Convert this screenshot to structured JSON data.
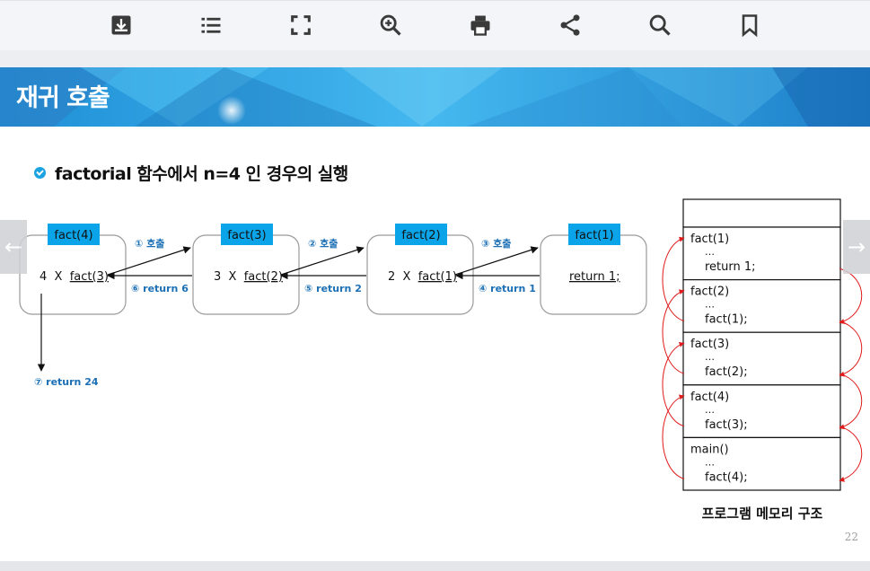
{
  "toolbar": {
    "buttons": [
      "download-icon",
      "list-icon",
      "fullscreen-icon",
      "zoom-in-icon",
      "print-icon",
      "share-icon",
      "search-icon",
      "bookmark-icon"
    ]
  },
  "slide": {
    "title": "재귀 호출",
    "heading": "factorial 함수에서 n=4 인 경우의 실행",
    "page_number": "22"
  },
  "diagram": {
    "boxes": [
      {
        "tag": "fact(4)",
        "prefix": "4  X  ",
        "call": "fact(3)"
      },
      {
        "tag": "fact(3)",
        "prefix": "3  X  ",
        "call": "fact(2)"
      },
      {
        "tag": "fact(2)",
        "prefix": "2  X  ",
        "call": "fact(1)"
      },
      {
        "tag": "fact(1)",
        "prefix": "",
        "call": "return 1;"
      }
    ],
    "calls": [
      "① 호출",
      "② 호출",
      "③ 호출"
    ],
    "returns": [
      "⑥ return 6",
      "⑤ return 2",
      "④ return 1"
    ],
    "final_return": "⑦ return 24",
    "memory": {
      "frames": [
        {
          "name": "fact(1)",
          "dots": "…",
          "stmt": "return 1;"
        },
        {
          "name": "fact(2)",
          "dots": "…",
          "stmt": "fact(1);"
        },
        {
          "name": "fact(3)",
          "dots": "…",
          "stmt": "fact(2);"
        },
        {
          "name": "fact(4)",
          "dots": "…",
          "stmt": "fact(3);"
        },
        {
          "name": "main()",
          "dots": "…",
          "stmt": "fact(4);"
        }
      ],
      "caption": "프로그램 메모리 구조"
    }
  },
  "nav": {
    "prev": "←",
    "next": "→"
  },
  "colors": {
    "tag_bg": "#0ba4e8",
    "label_blue": "#1a6fb5",
    "red_arrow": "#e01b1b"
  }
}
